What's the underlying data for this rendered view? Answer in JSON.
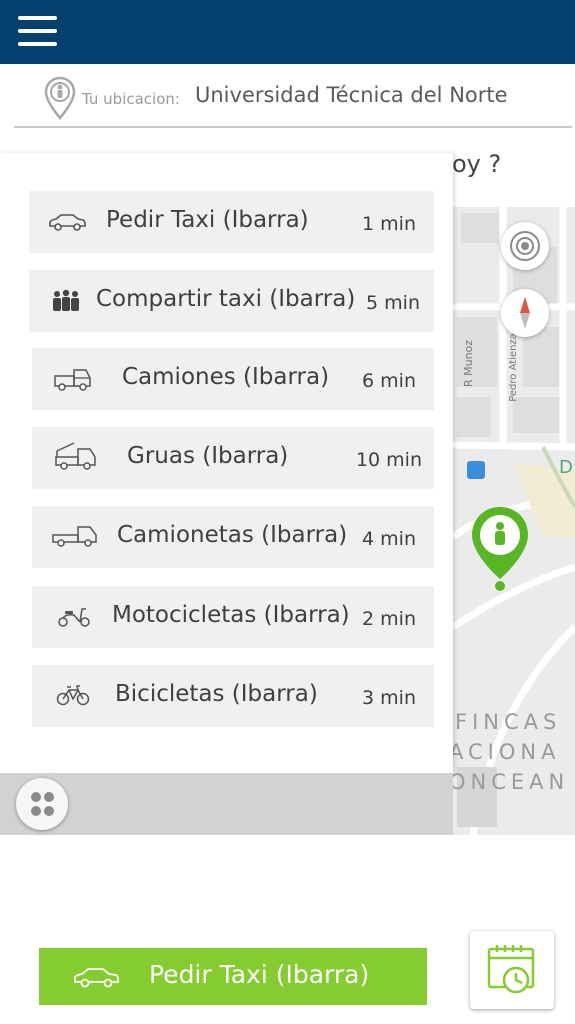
{
  "header": {
    "menu_icon": "hamburger-menu-icon"
  },
  "location": {
    "label": "Tu ubicacion:",
    "value": "Universidad Técnica del Norte",
    "icon": "person-pin-icon"
  },
  "question_partial": "oy ?",
  "vehicles": [
    {
      "name": "Pedir Taxi (Ibarra)",
      "time": "1 min",
      "icon": "car-icon"
    },
    {
      "name": "Compartir taxi (Ibarra)",
      "time": "5 min",
      "icon": "group-icon"
    },
    {
      "name": "Camiones (Ibarra)",
      "time": "6 min",
      "icon": "truck-icon"
    },
    {
      "name": "Gruas (Ibarra)",
      "time": "10 min",
      "icon": "tow-truck-icon"
    },
    {
      "name": "Camionetas (Ibarra)",
      "time": "4 min",
      "icon": "pickup-icon"
    },
    {
      "name": "Motocicletas (Ibarra)",
      "time": "2 min",
      "icon": "scooter-icon"
    },
    {
      "name": "Bicicletas (Ibarra)",
      "time": "3 min",
      "icon": "bicycle-icon"
    }
  ],
  "map": {
    "streets": [
      "R Munoz",
      "Pedro Atienza"
    ],
    "area_label_lines": [
      "FINCAS",
      "ACIONA",
      "ONCEAN"
    ],
    "edge_letter": "D",
    "marker_color": "#58b625",
    "bus_stop_icon": "bus-stop-icon"
  },
  "order_button": {
    "label": "Pedir Taxi (Ibarra)",
    "color": "#84cc2f"
  },
  "colors": {
    "topbar": "#04416e",
    "accent_green": "#84cc2f"
  }
}
